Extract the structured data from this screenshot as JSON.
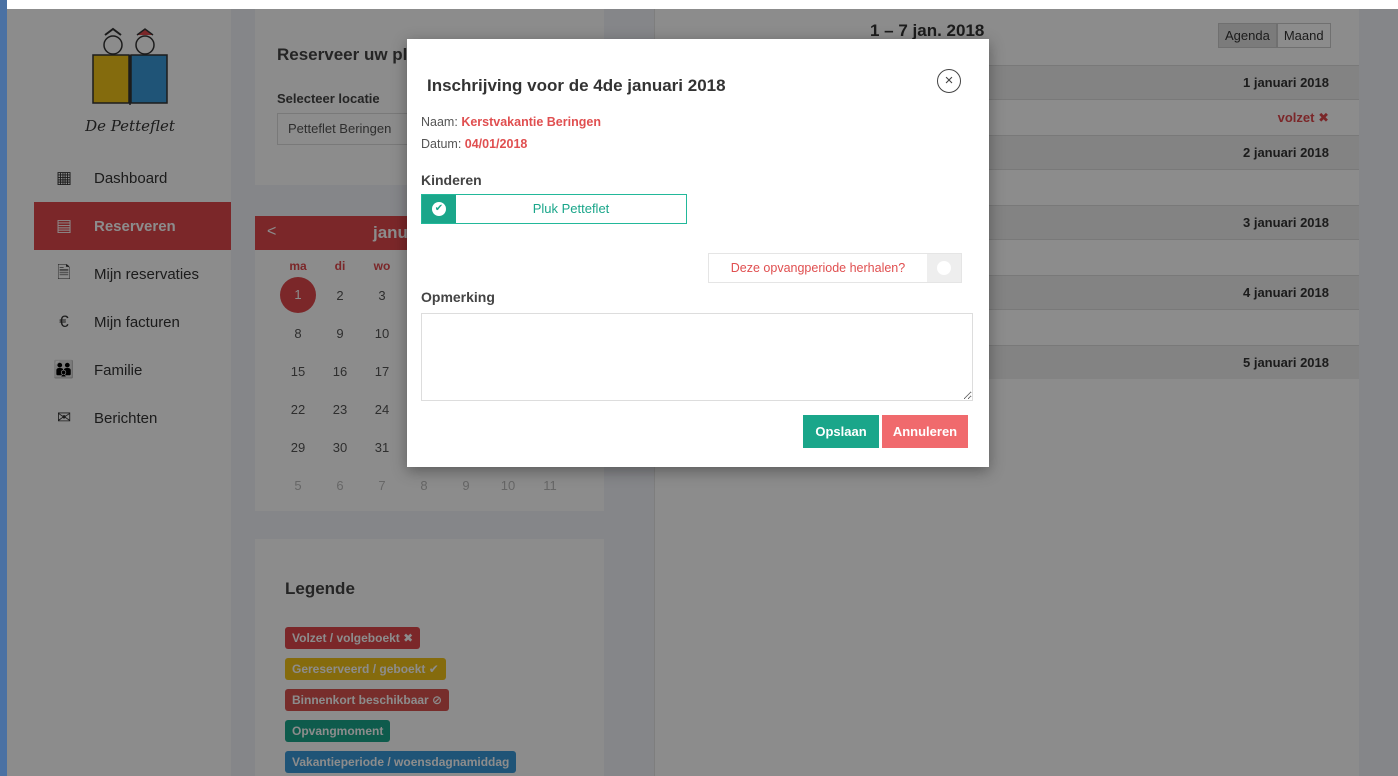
{
  "brand": {
    "logo_text": "De Petteflet"
  },
  "nav": [
    {
      "label": "Dashboard",
      "icon": "dashboard-icon",
      "glyph": "▦"
    },
    {
      "label": "Reserveren",
      "icon": "calendar-icon",
      "glyph": "▤"
    },
    {
      "label": "Mijn reservaties",
      "icon": "document-icon",
      "glyph": "🗎"
    },
    {
      "label": "Mijn facturen",
      "icon": "euro-icon",
      "glyph": "€"
    },
    {
      "label": "Familie",
      "icon": "family-icon",
      "glyph": "👪"
    },
    {
      "label": "Berichten",
      "icon": "envelope-icon",
      "glyph": "✉"
    }
  ],
  "reserve": {
    "title": "Reserveer uw pla",
    "location_label": "Selecteer locatie",
    "location_value": "Petteflet Beringen"
  },
  "mini_calendar": {
    "prev": "<",
    "month": "janu",
    "weekday_headers": [
      "ma",
      "di",
      "wo"
    ],
    "weeks": [
      [
        "1",
        "2",
        "3"
      ],
      [
        "8",
        "9",
        "10"
      ],
      [
        "15",
        "16",
        "17"
      ],
      [
        "22",
        "23",
        "24"
      ],
      [
        "29",
        "30",
        "31"
      ]
    ],
    "next_month_row": [
      "5",
      "6",
      "7",
      "8",
      "9",
      "10",
      "11"
    ]
  },
  "legend": {
    "title": "Legende",
    "items": [
      {
        "label": "Volzet / volgeboekt ✖",
        "color": "#e0474c"
      },
      {
        "label": "Gereserveerd / geboekt ✔",
        "color": "#f2c318"
      },
      {
        "label": "Binnenkort beschikbaar ⊘",
        "color": "#d9534f"
      },
      {
        "label": "Opvangmoment",
        "color": "#1aa68a"
      },
      {
        "label": "Vakantieperiode / woensdagnamiddag",
        "color": "#3a9ad9"
      }
    ]
  },
  "agenda": {
    "range": "1 – 7 jan. 2018",
    "views": [
      "Agenda",
      "Maand"
    ],
    "days": [
      {
        "label": "1 januari 2018",
        "status": "volzet ✖"
      },
      {
        "label": "2 januari 2018",
        "status": ""
      },
      {
        "label": "3 januari 2018",
        "status": ""
      },
      {
        "label": "4 januari 2018",
        "status": ""
      },
      {
        "label": "5 januari 2018",
        "status": ""
      }
    ]
  },
  "modal": {
    "title": "Inschrijving voor de 4de januari 2018",
    "close": "×",
    "naam_label": "Naam:",
    "naam_value": "Kerstvakantie Beringen",
    "datum_label": "Datum:",
    "datum_value": "04/01/2018",
    "kinderen_label": "Kinderen",
    "child_name": "Pluk Petteflet",
    "repeat_label": "Deze opvangperiode herhalen?",
    "opmerking_label": "Opmerking",
    "opmerking_value": "",
    "save_label": "Opslaan",
    "cancel_label": "Annuleren"
  }
}
